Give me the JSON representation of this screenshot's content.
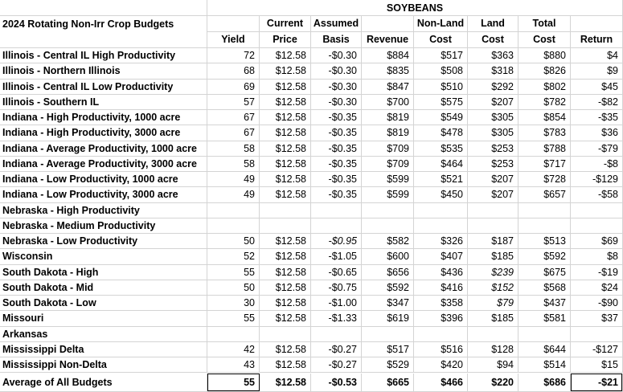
{
  "header": {
    "section_title": "SOYBEANS",
    "table_title": "2024 Rotating Non-Irr Crop Budgets",
    "columns_top": [
      "",
      "Current",
      "Assumed",
      "",
      "Non-Land",
      "Land",
      "Total",
      ""
    ],
    "columns_bottom": [
      "Yield",
      "Price",
      "Basis",
      "Revenue",
      "Cost",
      "Cost",
      "Cost",
      "Return"
    ]
  },
  "rows": [
    {
      "name": "Illinois - Central IL High Productivity",
      "values": [
        "72",
        "$12.58",
        "-$0.30",
        "$884",
        "$517",
        "$363",
        "$880",
        "$4"
      ]
    },
    {
      "name": "Illinois - Northern Illinois",
      "values": [
        "68",
        "$12.58",
        "-$0.30",
        "$835",
        "$508",
        "$318",
        "$826",
        "$9"
      ]
    },
    {
      "name": "Illinois - Central IL Low Productivity",
      "values": [
        "69",
        "$12.58",
        "-$0.30",
        "$847",
        "$510",
        "$292",
        "$802",
        "$45"
      ]
    },
    {
      "name": "Illinois - Southern IL",
      "values": [
        "57",
        "$12.58",
        "-$0.30",
        "$700",
        "$575",
        "$207",
        "$782",
        "-$82"
      ]
    },
    {
      "name": "Indiana - High Productivity, 1000 acre",
      "values": [
        "67",
        "$12.58",
        "-$0.35",
        "$819",
        "$549",
        "$305",
        "$854",
        "-$35"
      ]
    },
    {
      "name": "Indiana - High Productivity, 3000 acre",
      "values": [
        "67",
        "$12.58",
        "-$0.35",
        "$819",
        "$478",
        "$305",
        "$783",
        "$36"
      ]
    },
    {
      "name": "Indiana - Average Productivity, 1000 acre",
      "values": [
        "58",
        "$12.58",
        "-$0.35",
        "$709",
        "$535",
        "$253",
        "$788",
        "-$79"
      ]
    },
    {
      "name": "Indiana - Average Productivity, 3000 acre",
      "values": [
        "58",
        "$12.58",
        "-$0.35",
        "$709",
        "$464",
        "$253",
        "$717",
        "-$8"
      ]
    },
    {
      "name": "Indiana - Low Productivity, 1000 acre",
      "values": [
        "49",
        "$12.58",
        "-$0.35",
        "$599",
        "$521",
        "$207",
        "$728",
        "-$129"
      ]
    },
    {
      "name": "Indiana - Low Productivity, 3000 acre",
      "values": [
        "49",
        "$12.58",
        "-$0.35",
        "$599",
        "$450",
        "$207",
        "$657",
        "-$58"
      ]
    },
    {
      "name": "Nebraska - High Productivity",
      "values": [
        "",
        "",
        "",
        "",
        "",
        "",
        "",
        ""
      ]
    },
    {
      "name": "Nebraska - Medium Productivity",
      "values": [
        "",
        "",
        "",
        "",
        "",
        "",
        "",
        ""
      ]
    },
    {
      "name": "Nebraska - Low Productivity",
      "values": [
        "50",
        "$12.58",
        "-$0.95",
        "$582",
        "$326",
        "$187",
        "$513",
        "$69"
      ],
      "italic": [
        2
      ]
    },
    {
      "name": "Wisconsin",
      "values": [
        "52",
        "$12.58",
        "-$1.05",
        "$600",
        "$407",
        "$185",
        "$592",
        "$8"
      ]
    },
    {
      "name": "South Dakota - High",
      "values": [
        "55",
        "$12.58",
        "-$0.65",
        "$656",
        "$436",
        "$239",
        "$675",
        "-$19"
      ],
      "italic": [
        5
      ]
    },
    {
      "name": "South Dakota - Mid",
      "values": [
        "50",
        "$12.58",
        "-$0.75",
        "$592",
        "$416",
        "$152",
        "$568",
        "$24"
      ],
      "italic": [
        5
      ]
    },
    {
      "name": "South Dakota -   Low",
      "values": [
        "30",
        "$12.58",
        "-$1.00",
        "$347",
        "$358",
        "$79",
        "$437",
        "-$90"
      ],
      "italic": [
        5
      ]
    },
    {
      "name": "Missouri",
      "values": [
        "55",
        "$12.58",
        "-$1.33",
        "$619",
        "$396",
        "$185",
        "$581",
        "$37"
      ]
    },
    {
      "name": "Arkansas",
      "values": [
        "",
        "",
        "",
        "",
        "",
        "",
        "",
        ""
      ]
    },
    {
      "name": "Mississippi Delta",
      "values": [
        "42",
        "$12.58",
        "-$0.27",
        "$517",
        "$516",
        "$128",
        "$644",
        "-$127"
      ]
    },
    {
      "name": "Mississippi Non-Delta",
      "values": [
        "43",
        "$12.58",
        "-$0.27",
        "$529",
        "$420",
        "$94",
        "$514",
        "$15"
      ]
    }
  ],
  "average": {
    "name": "Average of All Budgets",
    "values": [
      "55",
      "$12.58",
      "-$0.53",
      "$665",
      "$466",
      "$220",
      "$686",
      "-$21"
    ]
  }
}
